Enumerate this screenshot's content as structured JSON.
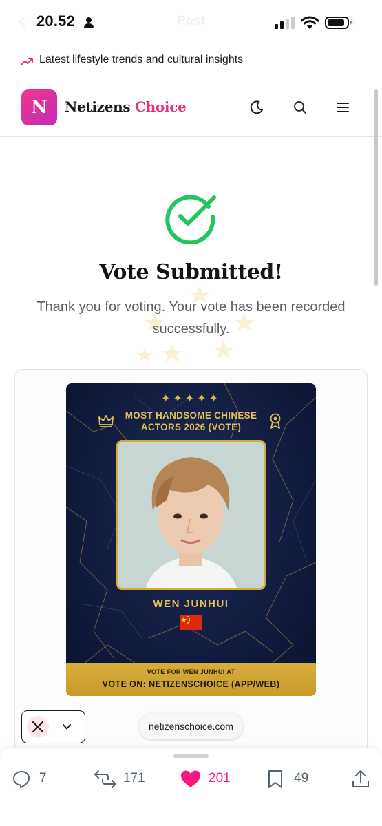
{
  "status_bar": {
    "time": "20.52",
    "ghost_title": "Post"
  },
  "trend_bar": {
    "icon": "trending-up-icon",
    "text": "Latest lifestyle trends and cultural insights",
    "accent_color": "#e0357c"
  },
  "header": {
    "logo_letter": "N",
    "brand_primary": "Netizens",
    "brand_accent": "Choice",
    "icons": [
      "moon-icon",
      "search-icon",
      "menu-icon"
    ]
  },
  "success": {
    "title": "Vote Submitted!",
    "message": "Thank you for voting. Your vote has been recorded successfully.",
    "check_color": "#22c55e"
  },
  "vote_card": {
    "title": "MOST HANDSOME CHINESE ACTORS 2026 (VOTE)",
    "nominee": "WEN JUNHUI",
    "footer_line1": "VOTE FOR WEN JUNHUI AT",
    "footer_line2": "VOTE ON: NETIZENSCHOICE (APP/WEB)",
    "gold_color": "#d4a935"
  },
  "overlay": {
    "url": "netizenschoice.com"
  },
  "actions": {
    "replies": "7",
    "reposts": "171",
    "likes": "201",
    "bookmarks": "49",
    "like_color": "#f91880"
  }
}
